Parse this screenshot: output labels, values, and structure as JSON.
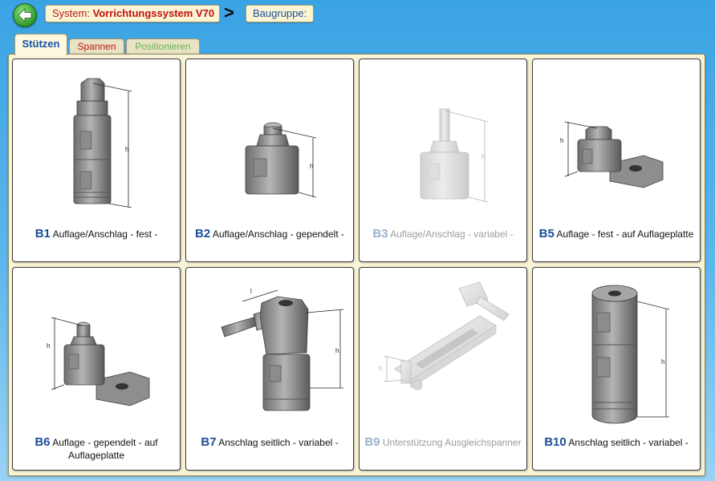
{
  "header": {
    "back_icon": "arrow-left-icon",
    "system_label": "System:",
    "system_value": "Vorrichtungssystem V70",
    "separator": ">",
    "baugruppe_label": "Baugruppe:"
  },
  "tabs": [
    {
      "label": "Stützen",
      "active": true
    },
    {
      "label": "Spannen",
      "active": false
    },
    {
      "label": "Positionieren",
      "active": false
    }
  ],
  "cards": [
    {
      "code": "B1",
      "text": "Auflage/Anschlag - fest -",
      "enabled": true,
      "icon": "support-fixed-icon"
    },
    {
      "code": "B2",
      "text": "Auflage/Anschlag - gependelt -",
      "enabled": true,
      "icon": "support-pendulum-icon"
    },
    {
      "code": "B3",
      "text": "Auflage/Anschlag - variabel -",
      "enabled": false,
      "icon": "support-variable-icon"
    },
    {
      "code": "B5",
      "text": "Auflage - fest - auf Auflageplatte",
      "enabled": true,
      "icon": "support-on-plate-icon"
    },
    {
      "code": "B6",
      "text": "Auflage - gependelt - auf Auflageplatte",
      "enabled": true,
      "icon": "pendulum-on-plate-icon"
    },
    {
      "code": "B7",
      "text": "Anschlag seitlich - variabel -",
      "enabled": true,
      "icon": "side-stop-variable-icon"
    },
    {
      "code": "B9",
      "text": "Unterstützung Ausgleichspanner",
      "enabled": false,
      "icon": "compensating-clamp-icon"
    },
    {
      "code": "B10",
      "text": "Anschlag seitlich - variabel -",
      "enabled": true,
      "icon": "side-stop-round-icon"
    }
  ],
  "colors": {
    "background": "#4aa9e6",
    "panel": "#f9f4d6",
    "code_blue": "#1b4f98",
    "system_red": "#c20f0f",
    "positionieren_green": "#67b25a"
  }
}
